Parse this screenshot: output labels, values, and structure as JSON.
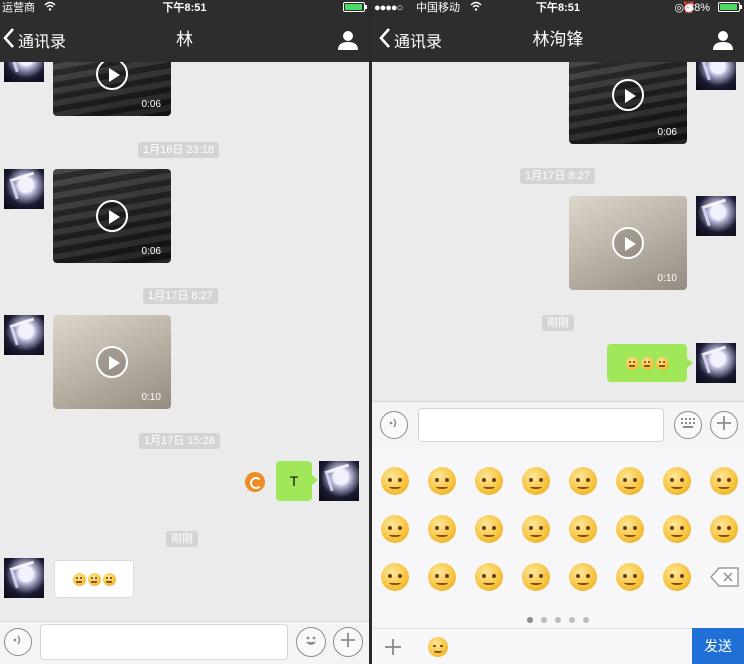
{
  "left_phone": {
    "status": {
      "carrier": "运营商",
      "time": "下午8:51"
    },
    "nav": {
      "back_label": "通讯录",
      "title": "林"
    },
    "timestamps": [
      "1月16日 23:18",
      "1月17日 8:27",
      "1月17日 15:28",
      "刚刚"
    ],
    "videos": [
      {
        "duration": "0:06"
      },
      {
        "duration": "0:06"
      },
      {
        "duration": "0:10"
      }
    ],
    "text_message": "T"
  },
  "right_phone": {
    "status": {
      "carrier": "中国移动",
      "time": "下午8:51",
      "battery": "88%"
    },
    "nav": {
      "back_label": "通讯录",
      "title": "林洵锋"
    },
    "timestamps": [
      "1月17日 8:27",
      "刚刚"
    ],
    "videos": [
      {
        "duration": "0:06"
      },
      {
        "duration": "0:10"
      }
    ],
    "emoji_page_dots": 5,
    "emoji_active_page": 1,
    "send_label": "发送"
  },
  "colors": {
    "nav_bg": "#2d2d2d",
    "chat_bg": "#ebebeb",
    "bubble_green": "#a0e75a",
    "send_blue": "#1f6fd6",
    "retry_orange": "#f08a24"
  }
}
